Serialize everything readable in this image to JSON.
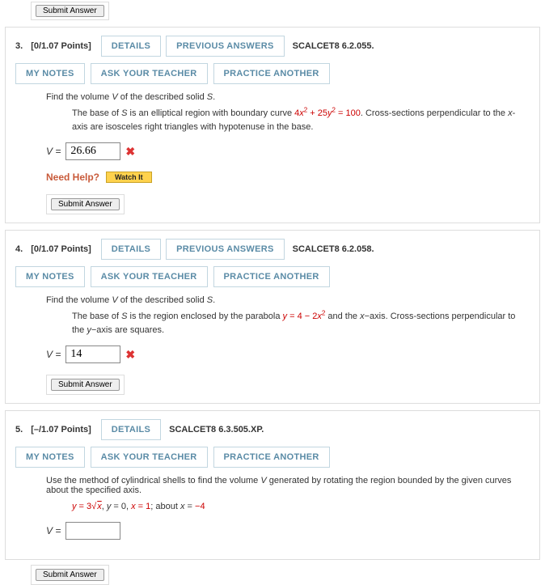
{
  "topSubmit": "Submit Answer",
  "buttons": {
    "details": "DETAILS",
    "previousAnswers": "PREVIOUS ANSWERS",
    "myNotes": "MY NOTES",
    "askTeacher": "ASK YOUR TEACHER",
    "practiceAnother": "PRACTICE ANOTHER"
  },
  "q3": {
    "num": "3.",
    "points": "[0/1.07 Points]",
    "source": "SCALCET8 6.2.055.",
    "prompt_a": "Find the volume ",
    "prompt_v": "V",
    "prompt_b": " of the described solid ",
    "prompt_s": "S",
    "prompt_c": ".",
    "desc_a": "The base of ",
    "desc_s": "S",
    "desc_b": " is an elliptical region with boundary curve ",
    "eq_a": "4",
    "eq_x": "x",
    "eq_b": " + 25",
    "eq_y": "y",
    "eq_c": " = 100",
    "desc_c": ". Cross-sections perpendicular to the ",
    "desc_x": "x",
    "desc_d": "-axis are isosceles right triangles with hypotenuse in the base.",
    "vlabel": "V = ",
    "answer": "26.66",
    "needHelp": "Need Help?",
    "watchIt": "Watch It",
    "submit": "Submit Answer"
  },
  "q4": {
    "num": "4.",
    "points": "[0/1.07 Points]",
    "source": "SCALCET8 6.2.058.",
    "prompt_a": "Find the volume ",
    "prompt_v": "V",
    "prompt_b": " of the described solid ",
    "prompt_s": "S",
    "prompt_c": ".",
    "desc_a": "The base of ",
    "desc_s": "S",
    "desc_b": " is the region enclosed by the parabola  ",
    "eq_y": "y",
    "eq_a": " = 4 − 2",
    "eq_x": "x",
    "desc_c": "  and the ",
    "desc_x": "x",
    "desc_d": "−axis. Cross-sections perpendicular to the ",
    "desc_y2": "y",
    "desc_e": "−axis are squares.",
    "vlabel": "V = ",
    "answer": "14",
    "submit": "Submit Answer"
  },
  "q5": {
    "num": "5.",
    "points": "[–/1.07 Points]",
    "source": "SCALCET8 6.3.505.XP.",
    "prompt": "Use the method of cylindrical shells to find the volume ",
    "prompt_v": "V",
    "prompt_b": " generated by rotating the region bounded by the given curves about the specified axis.",
    "eq_y": "y",
    "eq_a": " = 3",
    "eq_sqrt_x": "x",
    "eq_sep1": ",     ",
    "eq_y2": "y",
    "eq_b": " = 0,    ",
    "eq_x": "x",
    "eq_c": " = 1;     about ",
    "eq_x2": "x",
    "eq_d": " = ",
    "eq_val": "−4",
    "vlabel": "V = ",
    "answer": "",
    "submit": "Submit Answer"
  }
}
